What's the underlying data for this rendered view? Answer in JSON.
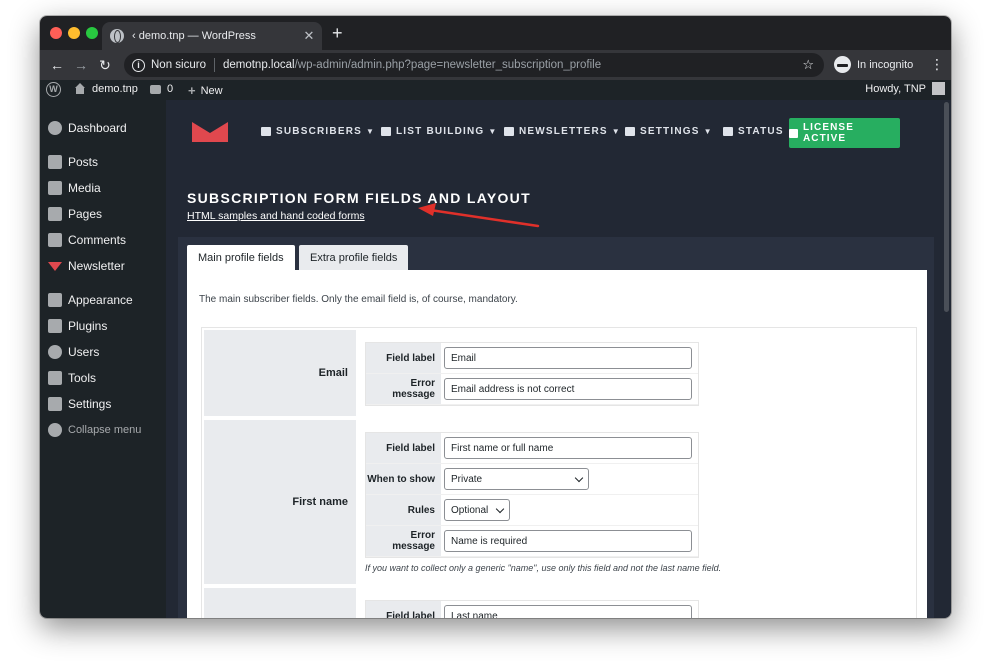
{
  "browser": {
    "tab_title": "‹ demo.tnp — WordPress",
    "tab_close": "✕",
    "new_tab": "+",
    "security_label": "Non sicuro",
    "url_host": "demotnp.local",
    "url_path": "/wp-admin/admin.php?page=newsletter_subscription_profile",
    "star": "☆",
    "incognito_label": "In incognito",
    "menu": "⋮",
    "back": "←",
    "forward": "→",
    "reload": "↻"
  },
  "adminbar": {
    "logo": "W",
    "site_name": "demo.tnp",
    "comments_count": "0",
    "new_label": "New",
    "new_plus": "+",
    "howdy": "Howdy, TNP"
  },
  "sidebar": {
    "items": [
      {
        "label": "Dashboard",
        "icon": "dashboard-icon"
      },
      {
        "label": "Posts",
        "icon": "pin-icon"
      },
      {
        "label": "Media",
        "icon": "media-icon"
      },
      {
        "label": "Pages",
        "icon": "pages-icon"
      },
      {
        "label": "Comments",
        "icon": "comments-icon"
      },
      {
        "label": "Newsletter",
        "icon": "newsletter-icon"
      },
      {
        "label": "Appearance",
        "icon": "brush-icon"
      },
      {
        "label": "Plugins",
        "icon": "plugin-icon"
      },
      {
        "label": "Users",
        "icon": "user-icon"
      },
      {
        "label": "Tools",
        "icon": "wrench-icon"
      },
      {
        "label": "Settings",
        "icon": "settings-icon"
      },
      {
        "label": "Collapse menu",
        "icon": "collapse-icon"
      }
    ]
  },
  "tnp_nav": {
    "items": [
      {
        "label": "SUBSCRIBERS",
        "icon": "users-icon",
        "caret": "▼"
      },
      {
        "label": "LIST BUILDING",
        "icon": "list-icon",
        "caret": "▼"
      },
      {
        "label": "NEWSLETTERS",
        "icon": "newspaper-icon",
        "caret": "▼"
      },
      {
        "label": "SETTINGS",
        "icon": "cog-icon",
        "caret": "▼"
      },
      {
        "label": "STATUS",
        "icon": "wrench-icon",
        "caret": ""
      }
    ],
    "license": "LICENSE ACTIVE"
  },
  "page": {
    "title": "SUBSCRIPTION FORM FIELDS AND LAYOUT",
    "link": "HTML samples and hand coded forms",
    "tabs": [
      {
        "label": "Main profile fields",
        "active": true
      },
      {
        "label": "Extra profile fields",
        "active": false
      }
    ],
    "intro": "The main subscriber fields. Only the email field is, of course, mandatory."
  },
  "fields": {
    "email": {
      "name": "Email",
      "field_label_caption": "Field label",
      "field_label_value": "Email",
      "error_caption": "Error message",
      "error_value": "Email address is not correct"
    },
    "first_name": {
      "name": "First name",
      "field_label_caption": "Field label",
      "field_label_value": "First name or full name",
      "when_caption": "When to show",
      "when_value": "Private",
      "rules_caption": "Rules",
      "rules_value": "Optional",
      "error_caption": "Error message",
      "error_value": "Name is required",
      "hint": "If you want to collect only a generic \"name\", use only this field and not the last name field."
    },
    "last_name": {
      "field_label_caption": "Field label",
      "field_label_value": "Last name"
    }
  },
  "colors": {
    "accent_red": "#e0484e",
    "license_green": "#27ae60",
    "wp_dark": "#1d2327",
    "content_dark": "#222834"
  }
}
